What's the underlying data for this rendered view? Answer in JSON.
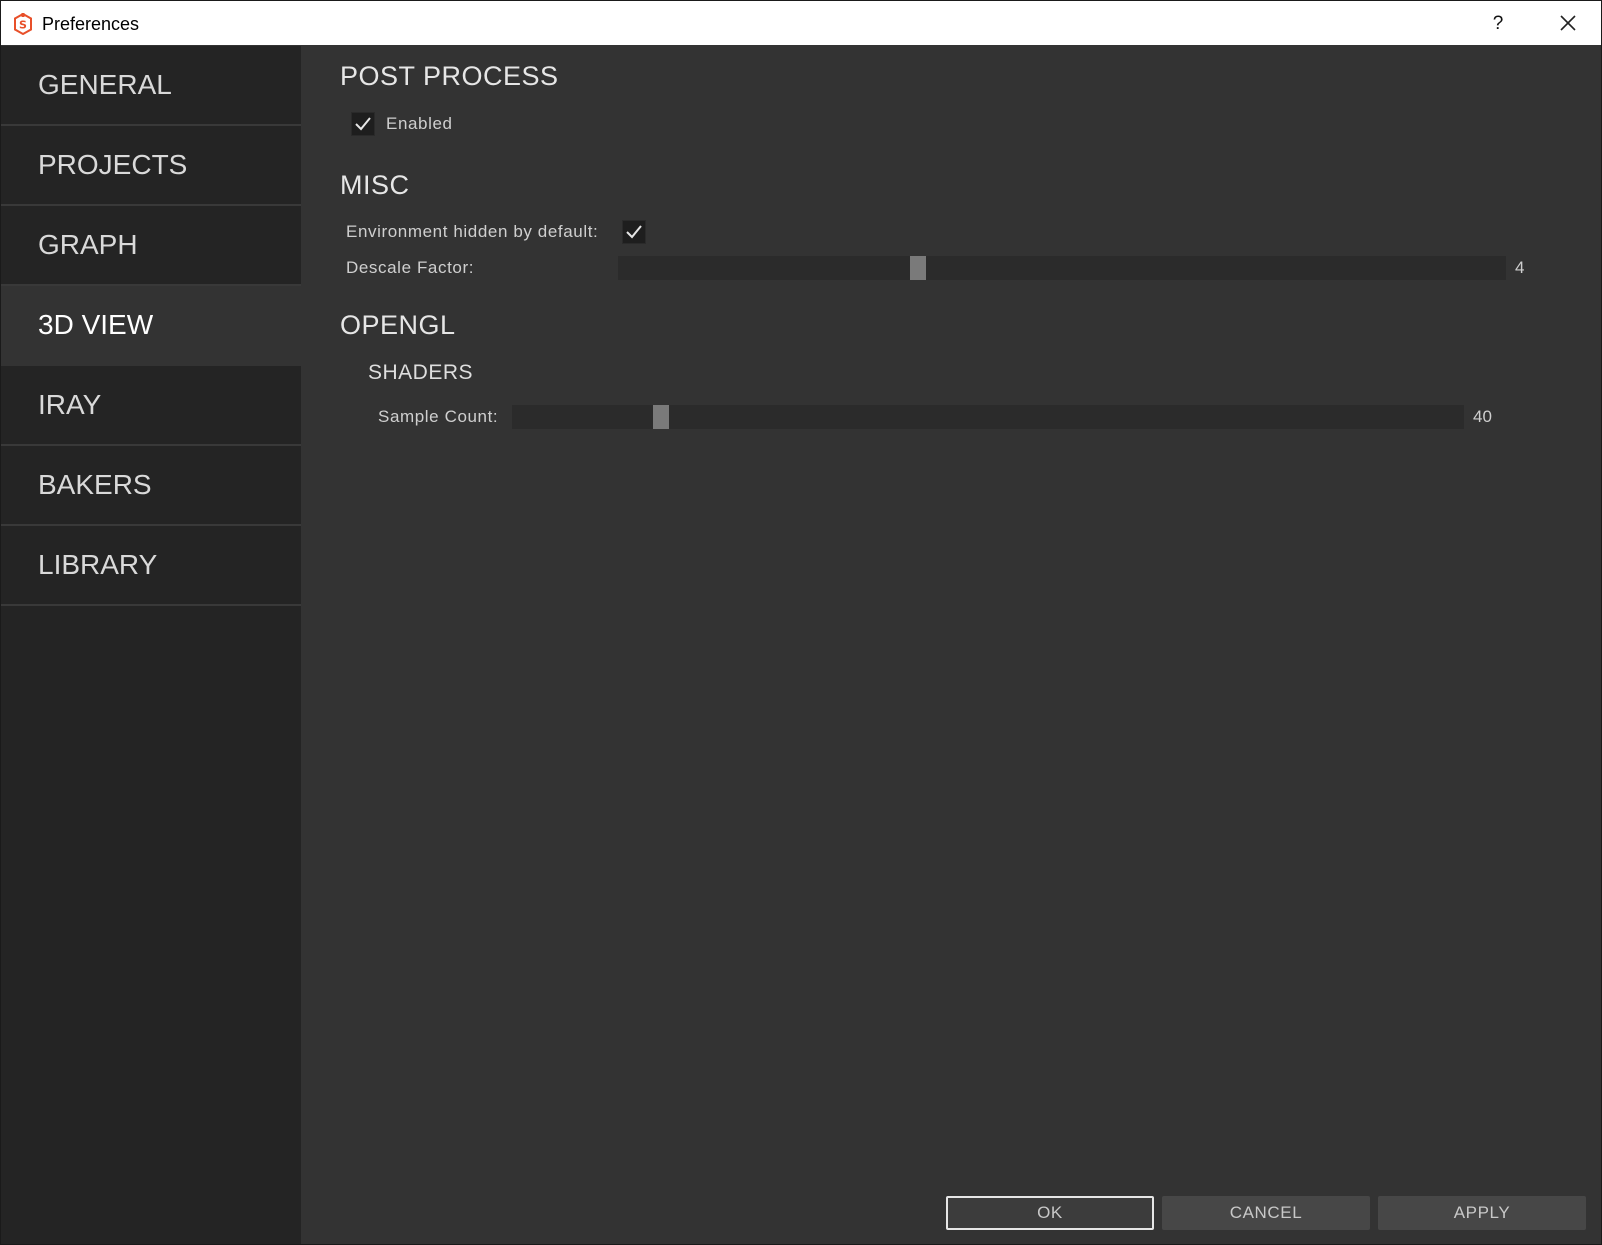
{
  "window": {
    "title": "Preferences",
    "help_label": "?"
  },
  "sidebar": {
    "items": [
      {
        "label": "GENERAL",
        "active": false
      },
      {
        "label": "PROJECTS",
        "active": false
      },
      {
        "label": "GRAPH",
        "active": false
      },
      {
        "label": "3D VIEW",
        "active": true
      },
      {
        "label": "IRAY",
        "active": false
      },
      {
        "label": "BAKERS",
        "active": false
      },
      {
        "label": "LIBRARY",
        "active": false
      }
    ]
  },
  "post_process": {
    "title": "POST PROCESS",
    "enabled_label": "Enabled",
    "enabled_checked": true
  },
  "misc": {
    "title": "MISC",
    "env_hidden_label": "Environment hidden by default:",
    "env_hidden_checked": true,
    "descale_label": "Descale Factor:",
    "descale_value": "4",
    "descale_fraction": 0.335
  },
  "opengl": {
    "title": "OPENGL",
    "shaders_title": "SHADERS",
    "sample_count_label": "Sample Count:",
    "sample_count_value": "40",
    "sample_count_fraction": 0.151
  },
  "footer": {
    "ok_label": "OK",
    "cancel_label": "CANCEL",
    "apply_label": "APPLY"
  },
  "colors": {
    "accent_icon": "#e8502a",
    "sidebar_bg": "#242424",
    "content_bg": "#333333"
  }
}
